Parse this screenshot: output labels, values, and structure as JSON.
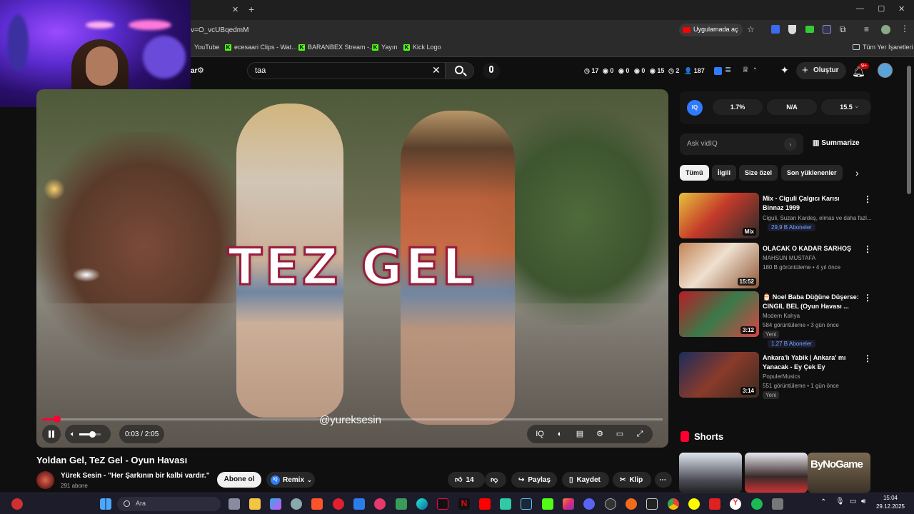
{
  "browser": {
    "url_fragment": "v=O_vcUBqedmM",
    "open_in_app": "Uygulamada aç",
    "bookmarks": [
      "YouTube",
      "ecesaari Clips - Wat...",
      "BARANBEX Stream -...",
      "Yayın",
      "Kick Logo"
    ],
    "all_bookmarks": "Tüm Yer İşaretleri"
  },
  "youtube": {
    "filter_label": "ar",
    "search_value": "taa",
    "stats": [
      {
        "icon": "clock-icon",
        "value": "17"
      },
      {
        "icon": "eye-icon",
        "value": "0"
      },
      {
        "icon": "eye-icon",
        "value": "0"
      },
      {
        "icon": "eye-icon",
        "value": "0"
      },
      {
        "icon": "eye-icon",
        "value": "15"
      },
      {
        "icon": "clock-icon",
        "value": "2"
      },
      {
        "icon": "person-icon",
        "value": "187"
      }
    ],
    "create_label": "Oluştur",
    "notifications_badge": "9+"
  },
  "player": {
    "overlay_text": "TEZ GEL",
    "watermark": "@yureksesin",
    "time": "0:03 / 2:05",
    "progress_fraction": 0.024,
    "volume_fraction": 0.6
  },
  "video": {
    "title": "Yoldan Gel, TeZ Gel - Oyun Havası",
    "channel": "Yürek Sesin - \"Her Şarkının bir kalbi vardır.\"",
    "subscribers": "291 abone",
    "subscribe_label": "Abone ol",
    "remix_label": "Remix",
    "likes": "14",
    "share_label": "Paylaş",
    "save_label": "Kaydet",
    "clip_label": "Klip"
  },
  "vidiq": {
    "pills": [
      "1.7%",
      "N/A",
      "15.5"
    ],
    "ask_placeholder": "Ask vidIQ",
    "summarize_label": "Summarize"
  },
  "chips": [
    "Tümü",
    "İlgili",
    "Size özel",
    "Son yüklenenler"
  ],
  "recommendations": [
    {
      "title": "Mix - Ciguli  Çalgıcı Karısı Binnaz 1999",
      "meta1": "Ciguli, Suzan Kardeş, elmas ve daha fazl...",
      "subs_badge": "29,9 B Aboneler",
      "duration": "Mix"
    },
    {
      "title": "OLACAK O KADAR SARHOŞ",
      "meta1": "MAHSUN MUSTAFA",
      "meta2": "180 B görüntüleme • 4 yıl önce",
      "duration": "15:52"
    },
    {
      "title": "🎅 Noel Baba Düğüne Düşerse: CINGIL BEL (Oyun Havası ...",
      "meta1": "Modern Kahya",
      "meta2": "584 görüntüleme • 3 gün önce",
      "badge": "Yeni",
      "subs_badge": "1,27 B Aboneler",
      "duration": "3:12"
    },
    {
      "title": "Ankara'lı Yabik | Ankara' mı Yanacak - Ey Çek Ey",
      "meta1": "PopulerMusics",
      "meta2": "551 görüntüleme • 1 gün önce",
      "badge": "Yeni",
      "duration": "3:14"
    }
  ],
  "shorts_label": "Shorts",
  "shorts_overlay": "ByNoGame",
  "taskbar": {
    "search_label": "Ara",
    "time": "15:04",
    "date": "29.12.2025"
  }
}
